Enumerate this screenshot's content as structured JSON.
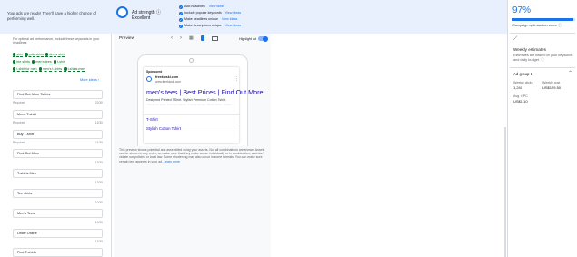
{
  "banner": {
    "message": "Your ads are ready! They'll have a higher chance of performing well.",
    "ad_strength_label": "Ad strength",
    "ad_strength_value": "Excellent",
    "checklist": [
      {
        "text": "Add headlines",
        "link": "View ideas"
      },
      {
        "text": "Include popular keywords",
        "link": "View ideas"
      },
      {
        "text": "Make headlines unique",
        "link": "View ideas"
      },
      {
        "text": "Make descriptions unique",
        "link": "View ideas"
      }
    ]
  },
  "left_panel": {
    "info": "For optimal ad performance, include these keywords in your headlines",
    "keyword_rows": [
      [
        "shirt",
        "polo shirts",
        "dress shirt"
      ],
      [
        "tee shirts",
        "men's tees",
        "t-shirt"
      ],
      [
        "t-shirt for men",
        "men's t-shirts",
        "t-shirts men"
      ]
    ],
    "more_ideas": "More ideas",
    "headlines": [
      {
        "value": "Find Out More Tshirts",
        "meta": "Required",
        "count": "22/30"
      },
      {
        "value": "Mens T-shirt",
        "meta": "Required",
        "count": "12/30"
      },
      {
        "value": "Buy T-shirt",
        "meta": "Required",
        "count": "11/30"
      },
      {
        "value": "Find Out More",
        "meta": "",
        "count": "13/30"
      },
      {
        "value": "T-shirts Men",
        "meta": "",
        "count": "12/30"
      },
      {
        "value": "Tee shirts",
        "meta": "",
        "count": "10/30"
      },
      {
        "value": "Men's Tees",
        "meta": "",
        "count": "10/30"
      },
      {
        "value": "Order Online",
        "meta": "",
        "count": "12/30"
      },
      {
        "value": "Find T-shirts",
        "meta": "",
        "count": ""
      }
    ]
  },
  "preview": {
    "title": "Preview",
    "highlight_label": "Highlight ad",
    "sponsored": "Sponsored",
    "domain": "freekioski.com",
    "display_url": "www.freekioski.com",
    "headline": "men's tees | Best Prices | Find Out More",
    "description": "Designed Printed TShirt. Stylish Premium Cotton Tshirt.",
    "description_faded": "Trendy for style. Trendy Fashion. Trendy design. Black Tshirt. Yellow...",
    "sitelinks": [
      "T-Shirt",
      "Stylish Cotton Tshirt"
    ],
    "note": "This preview shows potential ads assembled using your assets. Not all combinations are shown. Assets can be shown in any order, so make sure that they make sense individually or in combination, and don't violate our policies or local law. Some shortening may also occur in some formats. You can make sure certain text appears in your ad.",
    "learn_more": "Learn more"
  },
  "sidebar": {
    "score": "97%",
    "score_progress": 0.97,
    "score_label": "Campaign optimization score",
    "weekly_title": "Weekly estimates",
    "weekly_sub": "Estimates are based on your keywords and daily budget.",
    "ad_group": "Ad group 1",
    "stats": [
      {
        "label": "Weekly clicks",
        "value": "1,240"
      },
      {
        "label": "Weekly cost",
        "value": "US$129.50"
      },
      {
        "label": "Avg. CPC",
        "value": "US$0.10"
      }
    ]
  },
  "colors": {
    "accent": "#1a73e8",
    "keyword_green": "#137333",
    "banner_bg": "#e8f0fe"
  }
}
